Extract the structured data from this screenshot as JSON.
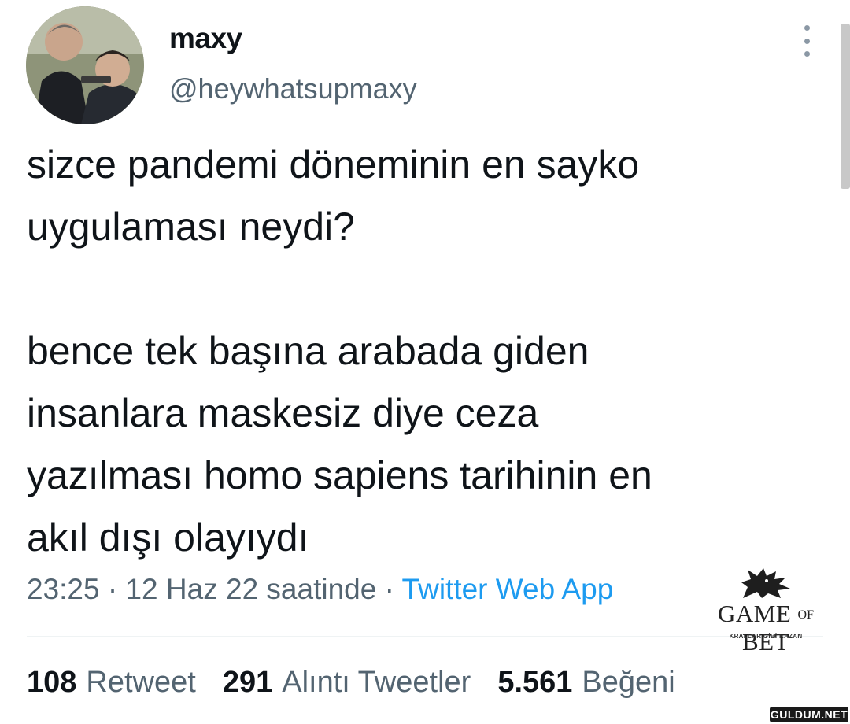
{
  "tweet": {
    "author": {
      "display_name": "maxy",
      "handle": "@heywhatsupmaxy"
    },
    "text": "sizce pandemi döneminin en sayko\nuygulaması neydi?\n\nbence tek başına arabada giden\ninsanlara maskesiz diye ceza\nyazılması homo sapiens tarihinin en\nakıl dışı olayıydı",
    "time": "23:25",
    "separator_1": " · ",
    "date": "12 Haz 22 saatinde",
    "separator_2": " · ",
    "source": "Twitter Web App"
  },
  "stats": [
    {
      "count": "108",
      "label": "Retweet"
    },
    {
      "count": "291",
      "label": "Alıntı Tweetler"
    },
    {
      "count": "5.561",
      "label": "Beğeni"
    }
  ],
  "watermark": {
    "logo_text": "GAME OF BET",
    "tagline": "KRALLAR GİBİ KAZAN",
    "site": "GULDUM.NET"
  },
  "colors": {
    "text": "#0f1419",
    "secondary": "#536471",
    "link": "#1d9bf0"
  },
  "icons": {
    "more": "more-vertical-icon",
    "watermark_logo": "wolf-head-icon"
  }
}
